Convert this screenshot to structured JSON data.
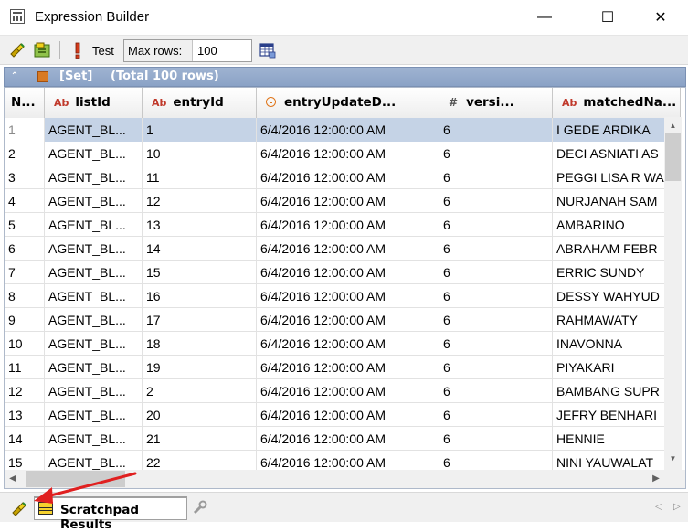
{
  "window": {
    "title": "Expression Builder",
    "minimize_glyph": "—",
    "maximize_glyph": "☐",
    "close_glyph": "✕"
  },
  "toolbar": {
    "test_label": "Test",
    "max_rows_label": "Max rows:",
    "max_rows_value": "100"
  },
  "result_set": {
    "label": "[Set]",
    "total": "(Total 100 rows)"
  },
  "grid": {
    "columns": [
      {
        "label": "N...",
        "type": "rownum"
      },
      {
        "label": "listId",
        "type": "text",
        "type_icon": "Ab"
      },
      {
        "label": "entryId",
        "type": "text",
        "type_icon": "Ab"
      },
      {
        "label": "entryUpdateD...",
        "type": "datetime",
        "type_icon": "clock"
      },
      {
        "label": "versi...",
        "type": "number",
        "type_icon": "#"
      },
      {
        "label": "matchedNa...",
        "type": "text",
        "type_icon": "Ab"
      }
    ],
    "rows": [
      [
        "1",
        "AGENT_BL...",
        "1",
        "6/4/2016 12:00:00 AM",
        "6",
        "I GEDE ARDIKA"
      ],
      [
        "2",
        "AGENT_BL...",
        "10",
        "6/4/2016 12:00:00 AM",
        "6",
        "DECI ASNIATI AS"
      ],
      [
        "3",
        "AGENT_BL...",
        "11",
        "6/4/2016 12:00:00 AM",
        "6",
        "PEGGI LISA R WA"
      ],
      [
        "4",
        "AGENT_BL...",
        "12",
        "6/4/2016 12:00:00 AM",
        "6",
        "NURJANAH SAM"
      ],
      [
        "5",
        "AGENT_BL...",
        "13",
        "6/4/2016 12:00:00 AM",
        "6",
        "AMBARINO"
      ],
      [
        "6",
        "AGENT_BL...",
        "14",
        "6/4/2016 12:00:00 AM",
        "6",
        "ABRAHAM FEBR"
      ],
      [
        "7",
        "AGENT_BL...",
        "15",
        "6/4/2016 12:00:00 AM",
        "6",
        "ERRIC SUNDY"
      ],
      [
        "8",
        "AGENT_BL...",
        "16",
        "6/4/2016 12:00:00 AM",
        "6",
        "DESSY WAHYUD"
      ],
      [
        "9",
        "AGENT_BL...",
        "17",
        "6/4/2016 12:00:00 AM",
        "6",
        "RAHMAWATY"
      ],
      [
        "10",
        "AGENT_BL...",
        "18",
        "6/4/2016 12:00:00 AM",
        "6",
        "INAVONNA"
      ],
      [
        "11",
        "AGENT_BL...",
        "19",
        "6/4/2016 12:00:00 AM",
        "6",
        "PIYAKARI"
      ],
      [
        "12",
        "AGENT_BL...",
        "2",
        "6/4/2016 12:00:00 AM",
        "6",
        "BAMBANG SUPR"
      ],
      [
        "13",
        "AGENT_BL...",
        "20",
        "6/4/2016 12:00:00 AM",
        "6",
        "JEFRY BENHARI"
      ],
      [
        "14",
        "AGENT_BL...",
        "21",
        "6/4/2016 12:00:00 AM",
        "6",
        "HENNIE"
      ],
      [
        "15",
        "AGENT_BL...",
        "22",
        "6/4/2016 12:00:00 AM",
        "6",
        "NINI YAUWALAT"
      ]
    ],
    "selected_row": 0
  },
  "bottom": {
    "tab_label": "Scratchpad Results"
  },
  "colors": {
    "set_header": "#8fa6c9",
    "selected_row": "#c5d3e6",
    "annotation_arrow": "#e02020"
  }
}
